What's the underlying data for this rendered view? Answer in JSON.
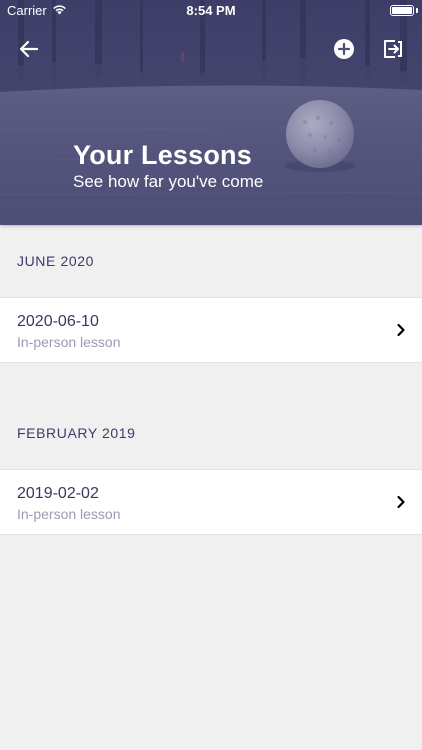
{
  "status_bar": {
    "carrier": "Carrier",
    "time": "8:54 PM",
    "icons": [
      "wifi-icon",
      "battery-icon"
    ]
  },
  "header": {
    "title": "Your Lessons",
    "subtitle": "See how far you've come",
    "background": "golf-ball-on-green-photo",
    "actions": {
      "back": "back-arrow-icon",
      "add": "plus-circle-icon",
      "logout": "logout-icon"
    }
  },
  "sections": [
    {
      "title": "JUNE 2020",
      "lessons": [
        {
          "date": "2020-06-10",
          "type": "In-person lesson",
          "chevron": "chevron-right-icon"
        }
      ]
    },
    {
      "title": "FEBRUARY 2019",
      "lessons": [
        {
          "date": "2019-02-02",
          "type": "In-person lesson",
          "chevron": "chevron-right-icon"
        }
      ]
    }
  ],
  "colors": {
    "accent_text": "#3e3b66",
    "secondary_text": "#9c9ab4",
    "background": "#f0f0f0",
    "row_background": "#ffffff",
    "header_tint": "#5d5f82"
  }
}
